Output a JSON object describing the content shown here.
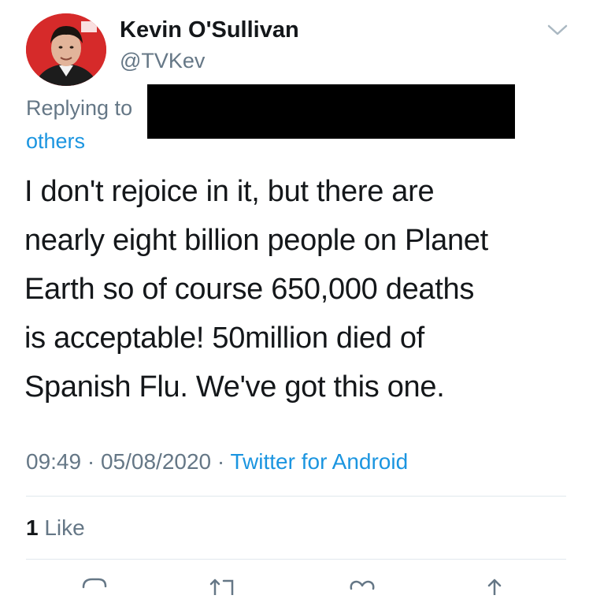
{
  "tweet": {
    "author": {
      "display_name": "Kevin O'Sullivan",
      "handle": "@TVKev",
      "avatar_icon": "profile-photo"
    },
    "replying": {
      "label": "Replying to",
      "link_text": "others"
    },
    "text_lines": [
      "I don't rejoice in it, but there are",
      "nearly eight billion people on Planet",
      "Earth so of course 650,000 deaths",
      "is acceptable! 50million died of",
      "Spanish Flu. We've got this one."
    ],
    "time": "09:49",
    "sep1": " · ",
    "date": "05/08/2020",
    "sep2": " · ",
    "source": "Twitter for Android",
    "likes_count": "1",
    "likes_label": " Like"
  },
  "icons": {
    "more": "chevron-down-icon",
    "reply": "reply-icon",
    "retweet": "retweet-icon",
    "like": "heart-icon",
    "share": "share-icon"
  },
  "colors": {
    "link": "#1b95e0",
    "secondary_text": "#657786",
    "primary_text": "#14171a",
    "divider": "#e1e8ed",
    "redaction": "#000000"
  }
}
